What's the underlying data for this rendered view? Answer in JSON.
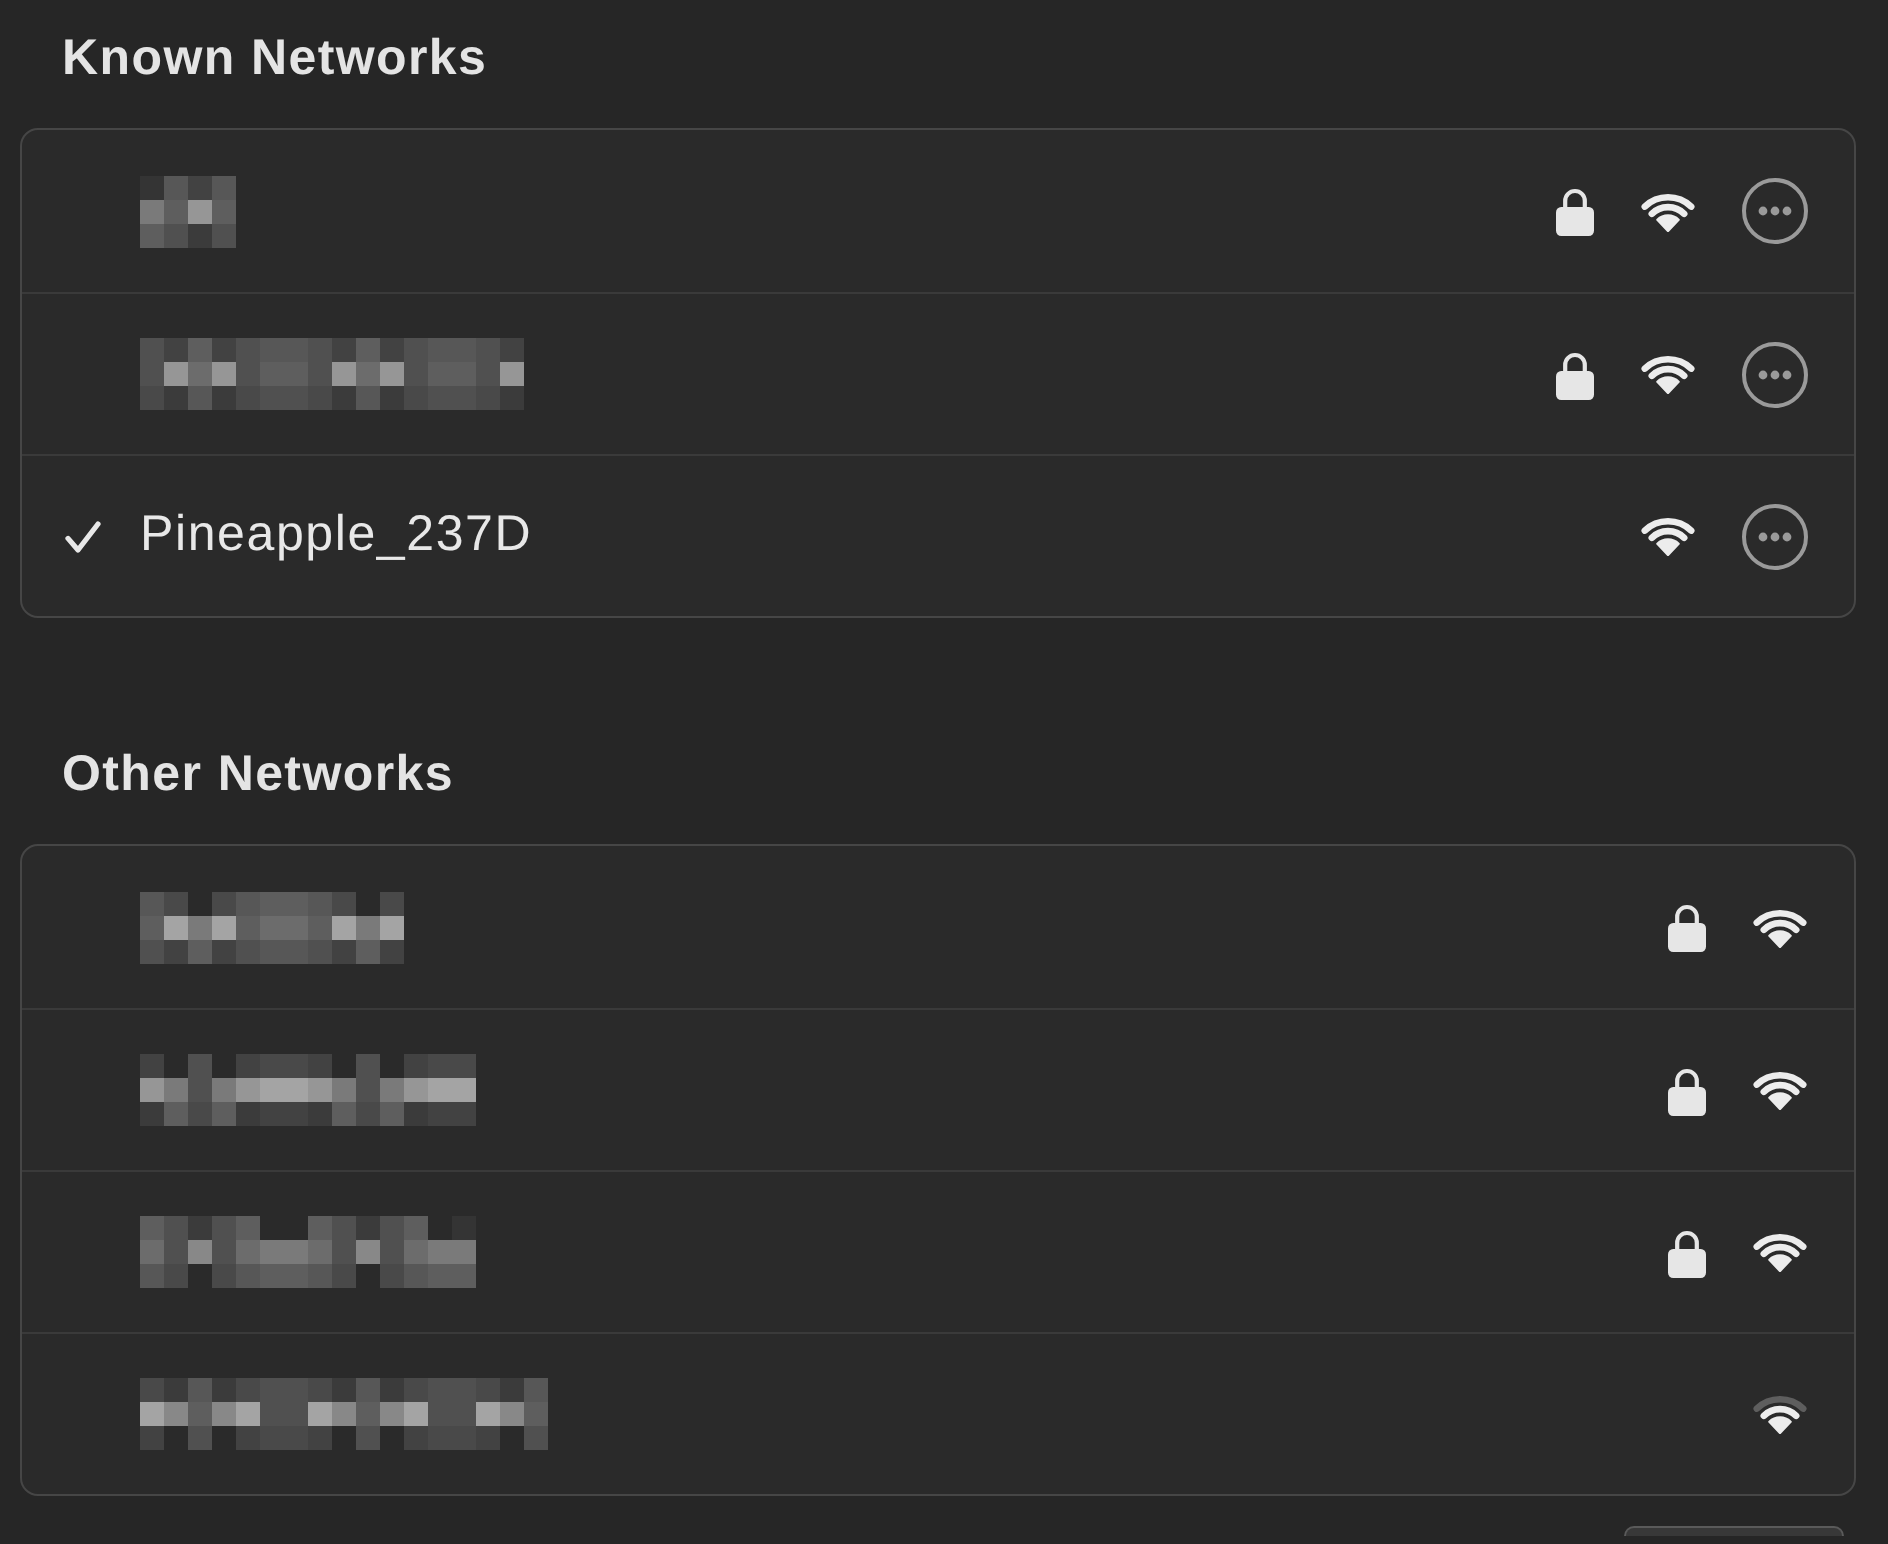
{
  "sections": [
    {
      "title": "Known Networks",
      "networks": [
        {
          "name_obscured": true,
          "connected": false,
          "secured": true,
          "weak_signal": false,
          "more_button": true
        },
        {
          "name_obscured": true,
          "connected": false,
          "secured": true,
          "weak_signal": false,
          "more_button": true
        },
        {
          "name_obscured": false,
          "name": "Pineapple_237D",
          "connected": true,
          "secured": false,
          "weak_signal": false,
          "more_button": true
        }
      ]
    },
    {
      "title": "Other Networks",
      "networks": [
        {
          "name_obscured": true,
          "connected": false,
          "secured": true,
          "weak_signal": false,
          "more_button": false
        },
        {
          "name_obscured": true,
          "connected": false,
          "secured": true,
          "weak_signal": false,
          "more_button": false
        },
        {
          "name_obscured": true,
          "connected": false,
          "secured": true,
          "weak_signal": false,
          "more_button": false
        },
        {
          "name_obscured": true,
          "connected": false,
          "secured": false,
          "weak_signal": true,
          "more_button": false
        }
      ]
    }
  ]
}
